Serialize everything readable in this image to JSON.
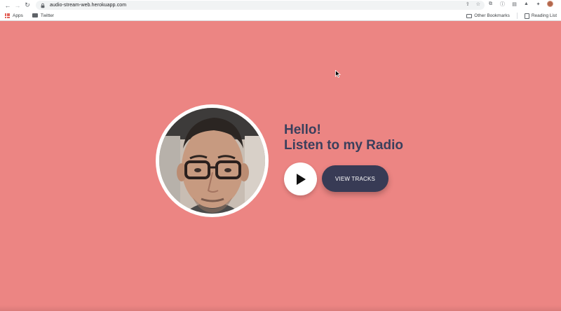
{
  "browser": {
    "url": "audio-stream-web.herokuapp.com",
    "bookmarks": [
      {
        "label": "Apps"
      },
      {
        "label": "Twitter"
      }
    ],
    "other_bookmarks": "Other Bookmarks",
    "reading_list": "Reading List"
  },
  "hero": {
    "line1": "Hello!",
    "line2": "Listen to my Radio",
    "view_tracks_label": "VIEW TRACKS"
  },
  "icons": {
    "back": "arrow-left-icon",
    "forward": "arrow-right-icon",
    "reload": "reload-icon",
    "lock": "lock-icon",
    "share": "share-icon",
    "bookmark_star": "star-icon",
    "play": "play-icon"
  },
  "colors": {
    "background": "#ec8583",
    "accent": "#383b55",
    "headline": "#3a3f5c"
  }
}
